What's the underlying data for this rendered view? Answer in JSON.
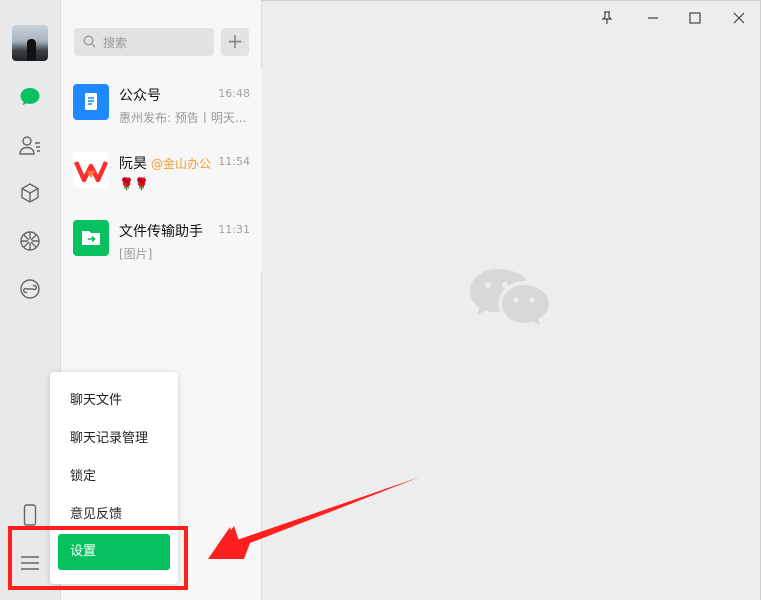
{
  "search": {
    "placeholder": "搜索",
    "add_label": "+"
  },
  "chats": [
    {
      "name": "公众号",
      "tag": "",
      "time": "16:48",
      "preview": "惠州发布: 预告丨明天...",
      "icon": "official-account-icon",
      "color": "#1e88ff"
    },
    {
      "name": "阮昊",
      "tag": "@金山办公",
      "time": "11:54",
      "preview": "🌹🌹",
      "icon": "wps-logo",
      "color": "#ff2d2d"
    },
    {
      "name": "文件传输助手",
      "tag": "",
      "time": "11:31",
      "preview": "[图片]",
      "icon": "file-transfer-icon",
      "color": "#07c160"
    }
  ],
  "menu": {
    "items": [
      "聊天文件",
      "聊天记录管理",
      "锁定",
      "意见反馈",
      "设置"
    ]
  },
  "colors": {
    "accent": "#07c160",
    "annotation": "#ff1f1f"
  }
}
